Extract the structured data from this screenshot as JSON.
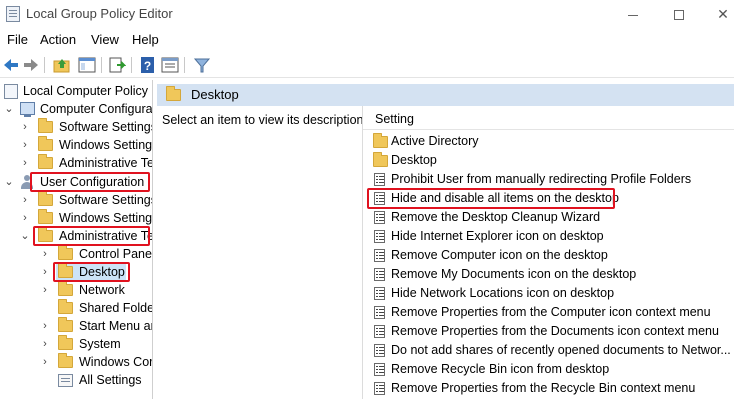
{
  "window": {
    "title": "Local Group Policy Editor",
    "controls": [
      "minimize",
      "maximize",
      "close"
    ]
  },
  "menubar": {
    "items": [
      "File",
      "Action",
      "View",
      "Help"
    ]
  },
  "toolbar": {
    "icons": [
      "back-icon",
      "forward-icon",
      "up-folder-icon",
      "show-hide-tree-icon",
      "export-list-icon",
      "help-icon",
      "properties-icon",
      "filter-icon"
    ]
  },
  "tree": {
    "root": "Local Computer Policy",
    "computer_config": "Computer Configura",
    "computer_children": [
      "Software Settings",
      "Windows Setting",
      "Administrative Te"
    ],
    "user_config": "User Configuration",
    "user_children": [
      "Software Settings",
      "Windows Setting",
      "Administrative Te"
    ],
    "admin_children": [
      "Control Panel",
      "Desktop",
      "Network",
      "Shared Folder",
      "Start Menu ar",
      "System",
      "Windows Cor",
      "All Settings"
    ],
    "selected": "Desktop"
  },
  "right_pane": {
    "header": "Desktop",
    "description": "Select an item to view its description.",
    "column_header": "Setting",
    "rows": [
      {
        "label": "Active Directory",
        "type": "folder"
      },
      {
        "label": "Desktop",
        "type": "folder"
      },
      {
        "label": "Prohibit User from manually redirecting Profile Folders",
        "type": "policy"
      },
      {
        "label": "Hide and disable all items on the desktop",
        "type": "policy",
        "highlighted": true
      },
      {
        "label": "Remove the Desktop Cleanup Wizard",
        "type": "policy"
      },
      {
        "label": "Hide Internet Explorer icon on desktop",
        "type": "policy"
      },
      {
        "label": "Remove Computer icon on the desktop",
        "type": "policy"
      },
      {
        "label": "Remove My Documents icon on the desktop",
        "type": "policy"
      },
      {
        "label": "Hide Network Locations icon on desktop",
        "type": "policy"
      },
      {
        "label": "Remove Properties from the Computer icon context menu",
        "type": "policy"
      },
      {
        "label": "Remove Properties from the Documents icon context menu",
        "type": "policy"
      },
      {
        "label": "Do not add shares of recently opened documents to Networ...",
        "type": "policy"
      },
      {
        "label": "Remove Recycle Bin icon from desktop",
        "type": "policy"
      },
      {
        "label": "Remove Properties from the Recycle Bin context menu",
        "type": "policy"
      }
    ]
  },
  "colors": {
    "highlight_border": "#e0121f",
    "pane_header": "#d4e2f2",
    "selected_bg": "#cce4f7",
    "folder": "#f0c75a"
  }
}
